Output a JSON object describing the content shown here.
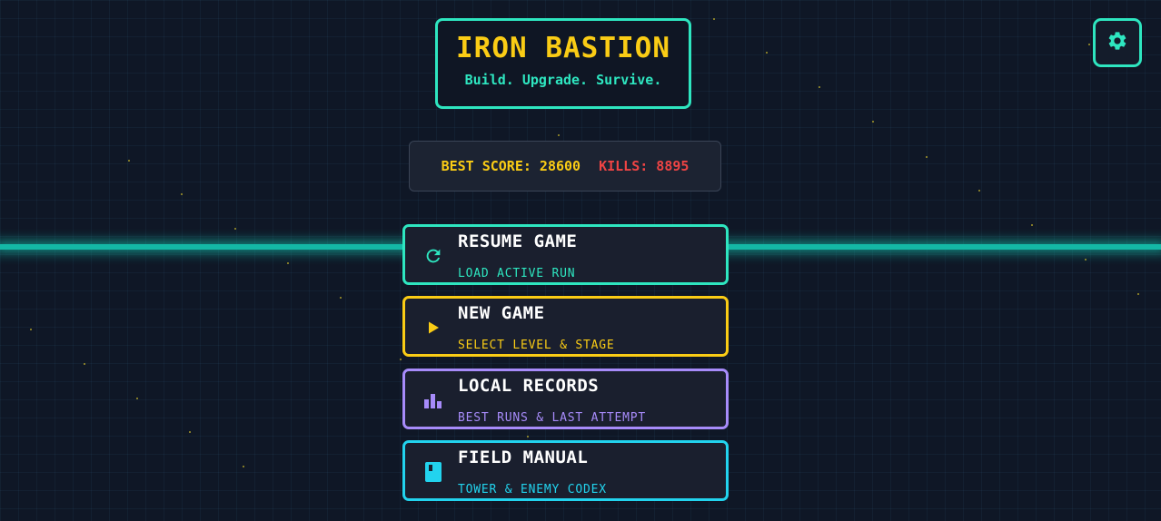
{
  "header": {
    "title": "IRON BASTION",
    "subtitle": "Build. Upgrade. Survive."
  },
  "stats": {
    "best_score": "BEST SCORE: 28600",
    "kills": "KILLS: 8895"
  },
  "settings": {
    "icon": "gear-icon"
  },
  "menu": [
    {
      "label": "RESUME GAME",
      "sub": "LOAD ACTIVE RUN",
      "icon": "refresh-icon",
      "color": "#2ee6c0"
    },
    {
      "label": "NEW GAME",
      "sub": "SELECT LEVEL & STAGE",
      "icon": "play-icon",
      "color": "#facc15"
    },
    {
      "label": "LOCAL RECORDS",
      "sub": "BEST RUNS & LAST ATTEMPT",
      "icon": "bar-chart-icon",
      "color": "#a78bfa"
    },
    {
      "label": "FIELD MANUAL",
      "sub": "TOWER & ENEMY CODEX",
      "icon": "book-icon",
      "color": "#22d3ee"
    }
  ],
  "colors": {
    "accent": "#2ee6c0",
    "gold": "#facc15",
    "red": "#ef4444",
    "purple": "#a78bfa",
    "cyan": "#22d3ee",
    "background": "#0f1726"
  }
}
